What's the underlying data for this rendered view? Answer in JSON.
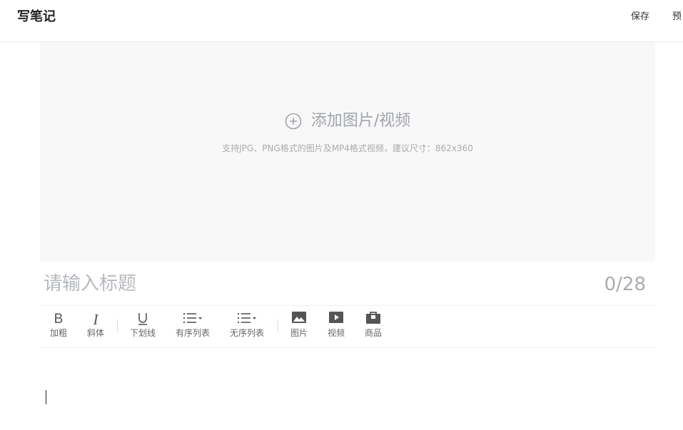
{
  "header": {
    "title": "写笔记",
    "save_label": "保存",
    "preview_label": "预"
  },
  "upload": {
    "label": "添加图片/视频",
    "hint": "支持JPG、PNG格式的图片及MP4格式视频，建议尺寸：862x360",
    "icon": "plus-circle-icon"
  },
  "title_field": {
    "placeholder": "请输入标题",
    "value": "",
    "counter": "0/28"
  },
  "toolbar": {
    "bold": {
      "label": "加粗",
      "glyph": "B",
      "icon": "bold-icon"
    },
    "italic": {
      "label": "斜体",
      "glyph": "I",
      "icon": "italic-icon"
    },
    "underline": {
      "label": "下划线",
      "glyph": "U",
      "icon": "underline-icon"
    },
    "ordered_list": {
      "label": "有序列表",
      "icon": "ordered-list-icon"
    },
    "unordered_list": {
      "label": "无序列表",
      "icon": "unordered-list-icon"
    },
    "image": {
      "label": "图片",
      "icon": "image-icon"
    },
    "video": {
      "label": "视频",
      "icon": "video-icon"
    },
    "product": {
      "label": "商品",
      "icon": "product-bag-icon"
    }
  },
  "colors": {
    "upload_bg": "#f8f8f8",
    "placeholder": "#b5b8bd",
    "icon": "#555555"
  }
}
